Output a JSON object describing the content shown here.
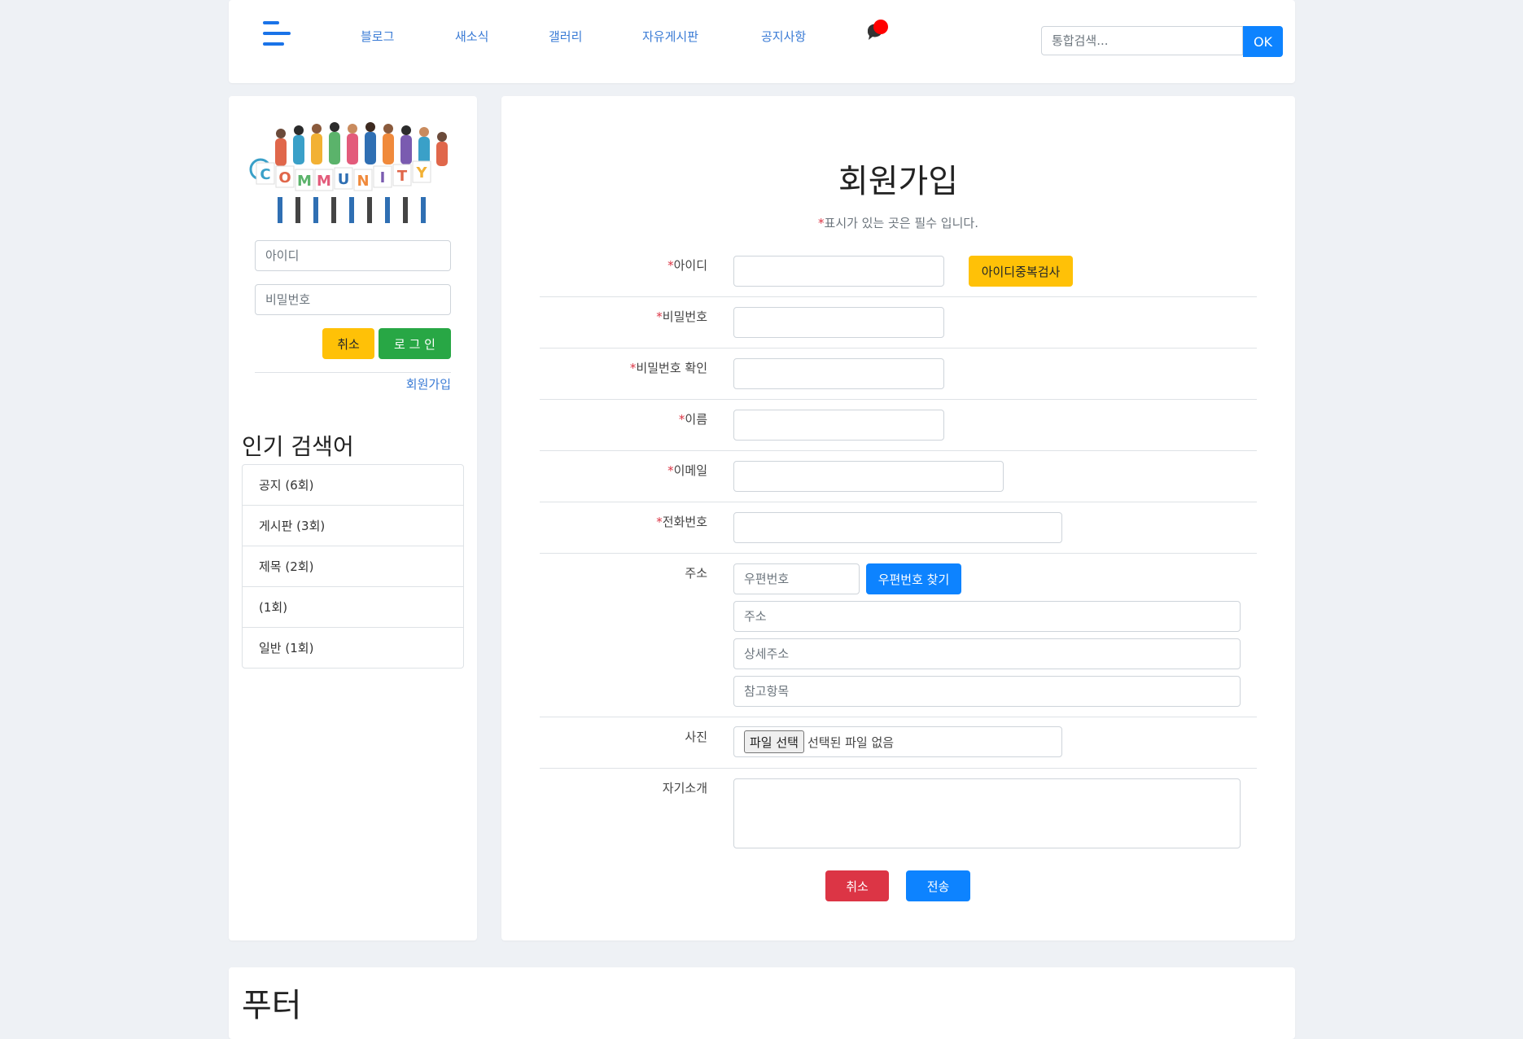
{
  "header": {
    "nav": [
      "블로그",
      "새소식",
      "갤러리",
      "자유게시판",
      "공지사항"
    ],
    "search_placeholder": "통합검색...",
    "search_button": "OK",
    "notification_color": "#ff0000"
  },
  "sidebar": {
    "logo_letters": [
      "C",
      "O",
      "M",
      "M",
      "U",
      "N",
      "I",
      "T",
      "Y"
    ],
    "id_placeholder": "아이디",
    "pw_placeholder": "비밀번호",
    "cancel_label": "취소",
    "login_label": "로 그 인",
    "signup_link": "회원가입",
    "popular_title": "인기 검색어",
    "popular": [
      "공지 (6회)",
      "게시판 (3회)",
      "제목 (2회)",
      "(1회)",
      "일반 (1회)"
    ]
  },
  "form": {
    "title": "회원가입",
    "note_star": "*",
    "note_text": "표시가 있는 곳은 필수 입니다.",
    "required_mark": "*",
    "labels": {
      "id": "아이디",
      "pw": "비밀번호",
      "pw_confirm": "비밀번호 확인",
      "name": "이름",
      "email": "이메일",
      "phone": "전화번호",
      "address": "주소",
      "photo": "사진",
      "intro": "자기소개"
    },
    "dup_check_label": "아이디중복검사",
    "zip_placeholder": "우편번호",
    "zip_button": "우편번호 찾기",
    "address_placeholder": "주소",
    "detail_placeholder": "상세주소",
    "extra_placeholder": "참고항목",
    "file_button": "파일 선택",
    "file_status": "선택된 파일 없음",
    "cancel_label": "취소",
    "submit_label": "전송"
  },
  "footer": {
    "title": "푸터"
  },
  "colors": {
    "primary": "#0d83ff",
    "warning": "#ffc107",
    "success": "#28a745",
    "danger": "#dc3545",
    "link": "#3a7bd5"
  }
}
